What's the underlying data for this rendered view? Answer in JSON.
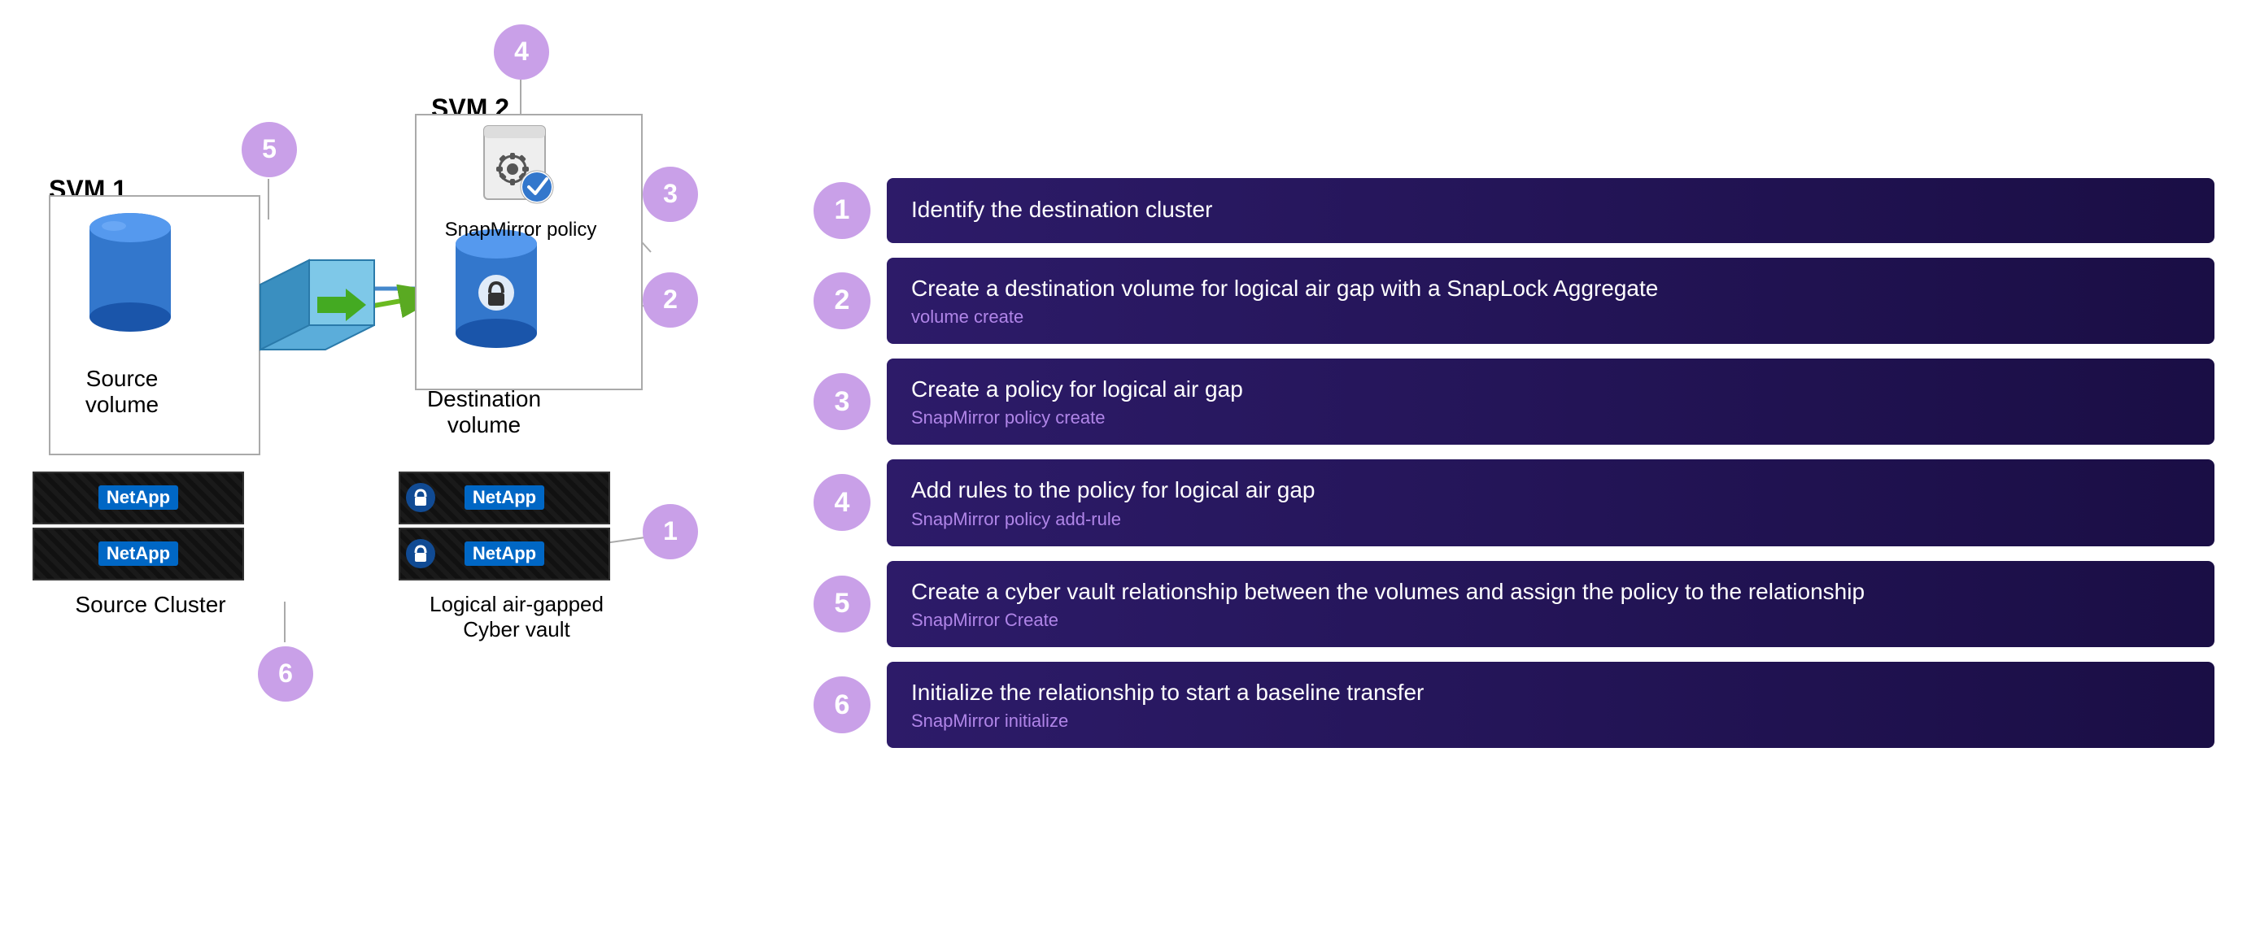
{
  "diagram": {
    "svm1_label": "SVM 1",
    "svm2_label": "SVM 2",
    "source_volume_label": "Source volume",
    "destination_volume_label": "Destination volume",
    "snapmirror_policy_label": "SnapMirror policy",
    "source_cluster_label": "Source Cluster",
    "dest_cluster_label": "Logical air-gapped\nCyber vault",
    "netapp_brand": "NetApp",
    "circles": [
      {
        "id": 1,
        "label": "1"
      },
      {
        "id": 2,
        "label": "2"
      },
      {
        "id": 3,
        "label": "3"
      },
      {
        "id": 4,
        "label": "4"
      },
      {
        "id": 5,
        "label": "5"
      },
      {
        "id": 6,
        "label": "6"
      }
    ]
  },
  "steps": [
    {
      "number": "1",
      "title": "Identify the destination cluster",
      "subtitle": ""
    },
    {
      "number": "2",
      "title": "Create a destination volume for logical air gap with a SnapLock Aggregate",
      "subtitle": "volume create"
    },
    {
      "number": "3",
      "title": "Create a policy for logical air gap",
      "subtitle": "SnapMirror policy create"
    },
    {
      "number": "4",
      "title": "Add rules to the policy for logical air gap",
      "subtitle": "SnapMirror policy add-rule"
    },
    {
      "number": "5",
      "title": "Create a cyber vault relationship between the volumes and assign the policy to the relationship",
      "subtitle": "SnapMirror Create"
    },
    {
      "number": "6",
      "title": "Initialize the relationship to start a baseline transfer",
      "subtitle": "SnapMirror initialize"
    }
  ]
}
